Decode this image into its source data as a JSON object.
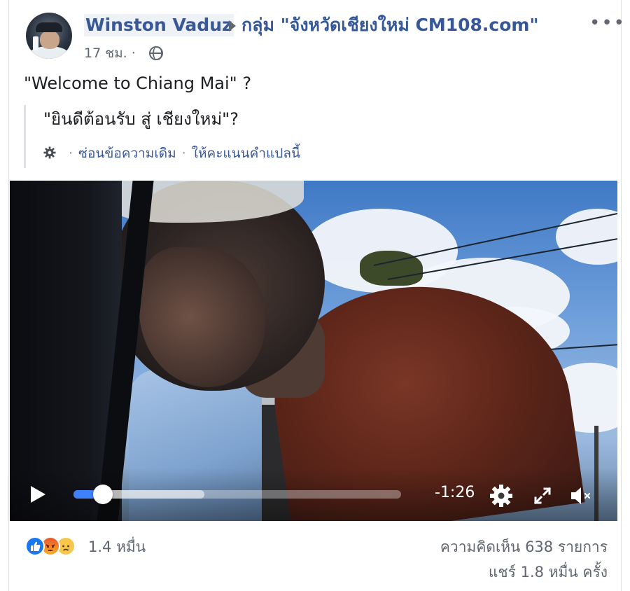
{
  "post": {
    "author": "Winston Vaduz",
    "group": "กลุ่ม \"จังหวัดเชียงใหม่ CM108.com\"",
    "time": "17 ชม. ·",
    "more_icon": "more-dots-icon",
    "privacy_icon": "globe-icon",
    "text": "\"Welcome to Chiang Mai\" ?"
  },
  "translation": {
    "text": "\"ยินดีต้อนรับ สู่ เชียงใหม่\"?",
    "hide_original": "ซ่อนข้อความเดิม",
    "rate_translation": "ให้คะแนนคำแปลนี้",
    "separator": "·",
    "settings_icon": "gear-icon"
  },
  "video": {
    "time_remaining": "-1:26",
    "progress": 0.09,
    "buffered": 0.4,
    "play_icon": "play-icon",
    "settings_icon": "gear-icon",
    "fullscreen_icon": "fullscreen-icon",
    "mute_icon": "speaker-muted-icon"
  },
  "footer": {
    "reactions": [
      "like",
      "angry",
      "sad"
    ],
    "reaction_count": "1.4 หมื่น",
    "comments": "ความคิดเห็น 638 รายการ",
    "shares": "แชร์ 1.8 หมื่น ครั้ง"
  },
  "colors": {
    "link": "#385898",
    "meta": "#606770",
    "accent": "#4080ff"
  }
}
